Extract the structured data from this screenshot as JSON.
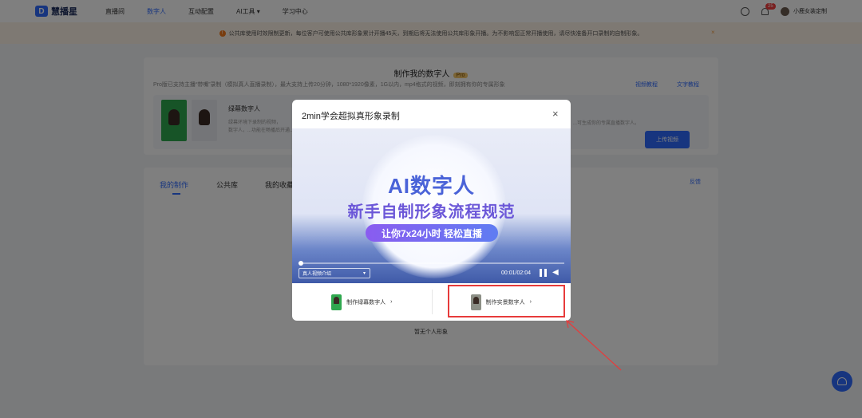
{
  "nav": {
    "logo": "慧播星",
    "items": [
      "直播间",
      "数字人",
      "互动配置",
      "AI工具 ▾",
      "学习中心"
    ],
    "notifications": "25",
    "user": "小鹿女装定制"
  },
  "notice": {
    "text": "公共库使用时效限制更新，每位客户可使用公共库形象累计开播45天，到期后将无法使用公共库形象开播。为不影响您正常开播使用，请尽快准备开口录制的自制形象。",
    "close": "×"
  },
  "create_card": {
    "title": "制作我的数字人",
    "pro": "Pro",
    "subtitle": "Pro版已支持主播“带嘴”录制（模拟真人直播录制），最大支持上传20分钟，1080*1920像素，1G以内，mp4格式的视频，即刻拥有你的专属形象",
    "tutorial_video": "视频教程",
    "tutorial_text": "文字教程",
    "green_label": "绿幕数字人",
    "desc_line1": "绿幕环境下录制的视频，",
    "desc_line2": "数字人，...功能在畅播后开通...",
    "desc_right": "...可生成你的专属直播数字人。",
    "upload": "上传视频"
  },
  "list_card": {
    "tabs": [
      "我的制作",
      "公共库",
      "我的收藏"
    ],
    "feedback": "反馈",
    "empty": "暂无个人形象"
  },
  "modal": {
    "title": "2min学会超拟真形象录制",
    "close": "×",
    "video": {
      "headline": "AI数字人",
      "subhead": "新手自制形象流程规范",
      "pill": "让你7x24小时 轻松直播",
      "select": "真人视频介绍",
      "time": "00:01/02:04",
      "progress": 0.01
    },
    "choices": [
      "制作绿幕数字人",
      "制作实景数字人"
    ]
  },
  "colors": {
    "accent": "#2f6bff",
    "annotation": "#e73b3b"
  }
}
